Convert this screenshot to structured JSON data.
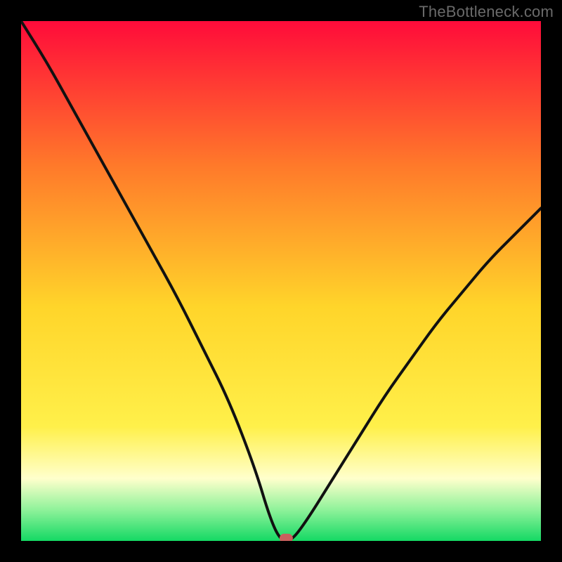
{
  "watermark": "TheBottleneck.com",
  "colors": {
    "frame": "#000000",
    "grad_top": "#ff0b3a",
    "grad_upper_mid": "#ff7a2a",
    "grad_mid": "#ffd52a",
    "grad_lower_mid": "#fff04a",
    "grad_pale": "#ffffcc",
    "grad_green_light": "#8ff29a",
    "grad_green": "#14d964",
    "curve": "#111111",
    "marker_fill": "#c9605e",
    "marker_stroke": "#c9605e"
  },
  "chart_data": {
    "type": "line",
    "title": "",
    "xlabel": "",
    "ylabel": "",
    "ylim": [
      0,
      100
    ],
    "xlim": [
      0,
      100
    ],
    "series": [
      {
        "name": "bottleneck-curve",
        "x": [
          0,
          5,
          10,
          15,
          20,
          25,
          30,
          35,
          40,
          45,
          48,
          50,
          52,
          55,
          60,
          65,
          70,
          75,
          80,
          85,
          90,
          95,
          100
        ],
        "values": [
          100,
          92,
          83,
          74,
          65,
          56,
          47,
          37,
          27,
          14,
          4,
          0,
          0,
          4,
          12,
          20,
          28,
          35,
          42,
          48,
          54,
          59,
          64
        ]
      }
    ],
    "marker": {
      "x": 51,
      "y": 0.5
    },
    "notes": "V-shaped bottleneck curve over vertical rainbow gradient; minimum sits near x≈51 at y≈0 with a small red marker; axes unlabeled; black frame border ~30px."
  }
}
